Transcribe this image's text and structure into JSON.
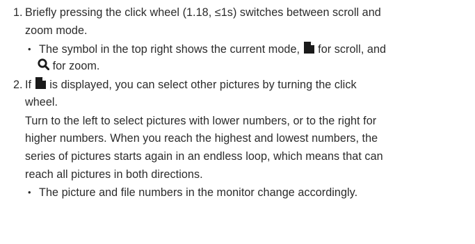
{
  "list": {
    "item1": {
      "number": "1.",
      "text_line1": "Briefly pressing the click wheel (1.18, ≤1s) switches between scroll and",
      "text_line2": "zoom mode.",
      "bullet": {
        "marker": "•",
        "text_before": "The symbol in the top right shows the current mode,",
        "text_scroll": "for scroll, and",
        "text_zoom": "for zoom."
      }
    },
    "item2": {
      "number": "2.",
      "text_if": "If",
      "text_line1_rest": "is displayed, you can select other pictures by turning the click",
      "text_line2": "wheel.",
      "para_line1": "Turn to the left to select pictures with lower numbers, or to the right for",
      "para_line2": "higher numbers. When you reach the highest and lowest numbers, the",
      "para_line3": "series of pictures starts again in an endless loop, which means that can",
      "para_line4": "reach all pictures in both directions.",
      "bullet": {
        "marker": "•",
        "text": "The picture and file numbers in the monitor change accordingly."
      }
    }
  },
  "icons": {
    "scroll": "document-scroll-icon",
    "zoom": "magnifier-zoom-icon"
  },
  "colors": {
    "text": "#2b2b2b"
  }
}
